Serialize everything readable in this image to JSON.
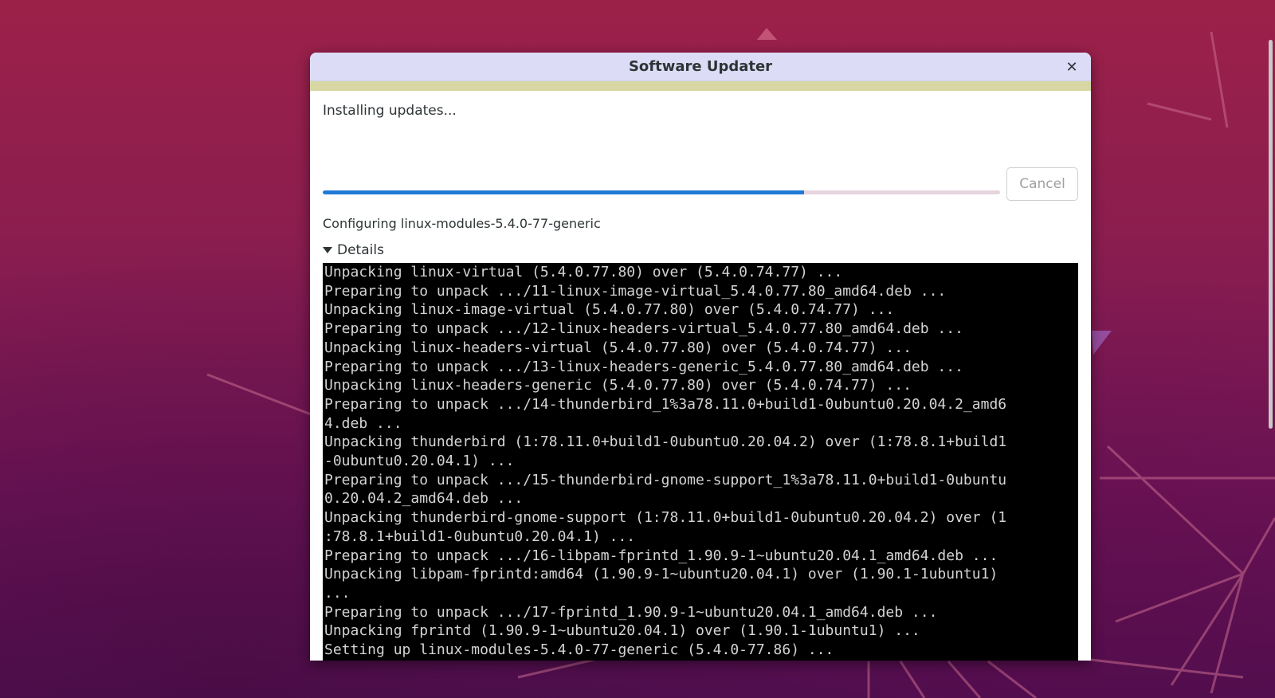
{
  "window": {
    "title": "Software Updater",
    "close_icon": "close-icon"
  },
  "status": {
    "heading": "Installing updates...",
    "current_action": "Configuring linux-modules-5.4.0-77-generic",
    "progress_fraction": 0.71
  },
  "buttons": {
    "cancel_label": "Cancel"
  },
  "details": {
    "label": "Details",
    "expanded": true,
    "toggle_icon": "triangle-down-icon"
  },
  "terminal": {
    "lines": [
      "Unpacking linux-virtual (5.4.0.77.80) over (5.4.0.74.77) ...",
      "Preparing to unpack .../11-linux-image-virtual_5.4.0.77.80_amd64.deb ...",
      "Unpacking linux-image-virtual (5.4.0.77.80) over (5.4.0.74.77) ...",
      "Preparing to unpack .../12-linux-headers-virtual_5.4.0.77.80_amd64.deb ...",
      "Unpacking linux-headers-virtual (5.4.0.77.80) over (5.4.0.74.77) ...",
      "Preparing to unpack .../13-linux-headers-generic_5.4.0.77.80_amd64.deb ...",
      "Unpacking linux-headers-generic (5.4.0.77.80) over (5.4.0.74.77) ...",
      "Preparing to unpack .../14-thunderbird_1%3a78.11.0+build1-0ubuntu0.20.04.2_amd6",
      "4.deb ...",
      "Unpacking thunderbird (1:78.11.0+build1-0ubuntu0.20.04.2) over (1:78.8.1+build1",
      "-0ubuntu0.20.04.1) ...",
      "Preparing to unpack .../15-thunderbird-gnome-support_1%3a78.11.0+build1-0ubuntu",
      "0.20.04.2_amd64.deb ...",
      "Unpacking thunderbird-gnome-support (1:78.11.0+build1-0ubuntu0.20.04.2) over (1",
      ":78.8.1+build1-0ubuntu0.20.04.1) ...",
      "Preparing to unpack .../16-libpam-fprintd_1.90.9-1~ubuntu20.04.1_amd64.deb ...",
      "Unpacking libpam-fprintd:amd64 (1.90.9-1~ubuntu20.04.1) over (1.90.1-1ubuntu1)",
      "...",
      "Preparing to unpack .../17-fprintd_1.90.9-1~ubuntu20.04.1_amd64.deb ...",
      "Unpacking fprintd (1.90.9-1~ubuntu20.04.1) over (1.90.1-1ubuntu1) ...",
      "Setting up linux-modules-5.4.0-77-generic (5.4.0-77.86) ..."
    ]
  },
  "colors": {
    "titlebar_bg": "#dcdcf6",
    "accent_strip": "#d8d6a2",
    "progress_fill": "#1f7ad6",
    "progress_track": "#e6d4de",
    "terminal_bg": "#000000",
    "terminal_fg": "#d3d3d3",
    "desktop_bg": "#8a1d4f"
  }
}
